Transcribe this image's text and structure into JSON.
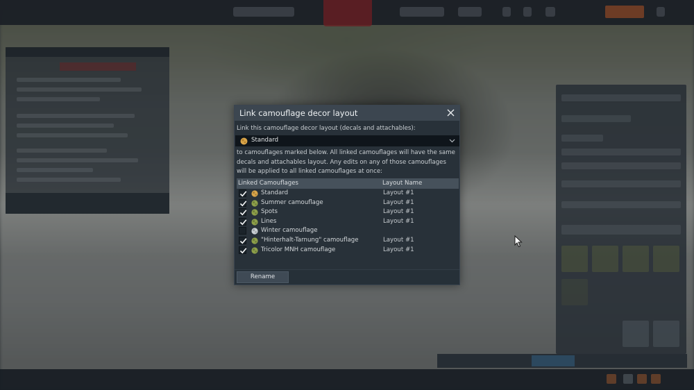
{
  "dialog": {
    "title": "Link camouflage decor layout",
    "intro": "Link this camouflage decor layout (decals and attachables):",
    "selected_camouflage": "Standard",
    "description": "to camouflages marked below. All linked camouflages will have the same decals and attachables layout. Any edits on any of those camouflages will be applied to all linked camouflages at once:",
    "columns": {
      "linked": "Linked Camouflages",
      "layout": "Layout Name"
    },
    "rows": [
      {
        "name": "Standard",
        "layout": "Layout #1",
        "checked": true,
        "icon_color": "#d9a54a"
      },
      {
        "name": "Summer camouflage",
        "layout": "Layout #1",
        "checked": true,
        "icon_color": "#8ea04a"
      },
      {
        "name": "Spots",
        "layout": "Layout #1",
        "checked": true,
        "icon_color": "#8ea04a"
      },
      {
        "name": "Lines",
        "layout": "Layout #1",
        "checked": true,
        "icon_color": "#8ea04a"
      },
      {
        "name": "Winter camouflage",
        "layout": "",
        "checked": false,
        "icon_color": "#c9cfd3"
      },
      {
        "name": "\"Hinterhalt-Tarnung\" camouflage",
        "layout": "Layout #1",
        "checked": true,
        "icon_color": "#8ea04a"
      },
      {
        "name": "Tricolor MNH camouflage",
        "layout": "Layout #1",
        "checked": true,
        "icon_color": "#8ea04a"
      }
    ],
    "rename_label": "Rename"
  },
  "icons": {
    "close": "close-icon",
    "dropdown": "chevron-down-icon",
    "check": "checkmark-icon",
    "camouflage": "camouflage-icon",
    "cursor": "mouse-cursor-icon"
  },
  "colors": {
    "dialog_bg": "#283139",
    "header_bg": "#3c4650",
    "selector_bg": "#0f151b",
    "table_header_bg": "#46515b"
  }
}
